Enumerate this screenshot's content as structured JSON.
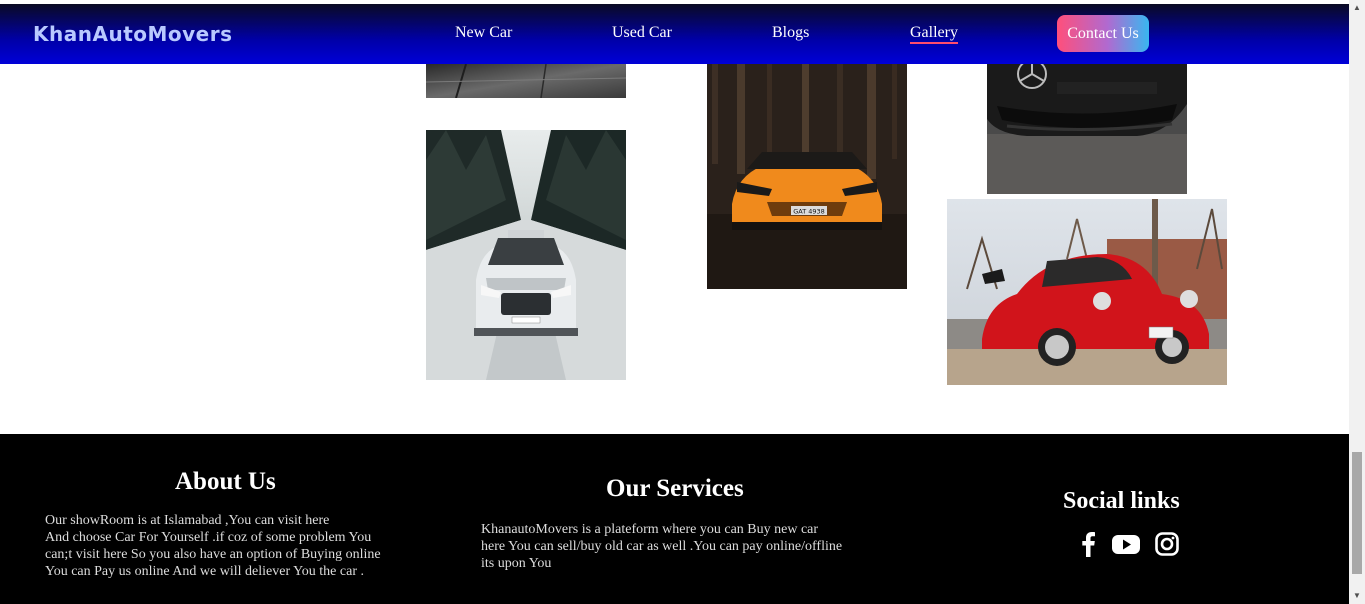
{
  "navbar": {
    "brand": "KhanAutoMovers",
    "links": [
      "New Car",
      "Used Car",
      "Blogs",
      "Gallery"
    ],
    "active": "Gallery",
    "contact": "Contact Us"
  },
  "gallery": {
    "photos": [
      {
        "subject": "dark-road-partial"
      },
      {
        "subject": "black-mercedes-front"
      },
      {
        "subject": "white-audi-snowy-forest"
      },
      {
        "subject": "orange-lamborghini-forest",
        "plate": "GAT 4938"
      },
      {
        "subject": "red-porsche-911"
      }
    ]
  },
  "footer": {
    "about": {
      "title": "About Us",
      "lines": [
        "Our showRoom is at Islamabad ,You can visit here",
        "And choose Car For Yourself .if coz of some problem You",
        "can;t visit here So you also have an option of Buying online",
        "You can Pay us online And we will deliever You the car ."
      ]
    },
    "services": {
      "title": "Our Services",
      "lines": [
        "KhanautoMovers is a plateform where you can Buy new car",
        "here You can sell/buy old car as well .You can pay online/offline",
        "its upon You"
      ]
    },
    "social": {
      "title": "Social links",
      "icons": [
        "facebook-icon",
        "youtube-icon",
        "instagram-icon"
      ]
    }
  }
}
